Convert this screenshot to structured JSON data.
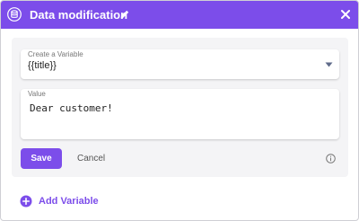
{
  "dialog": {
    "title": "Data modification",
    "title_icon": "database-icon",
    "edit_icon": "pencil-icon",
    "close_icon": "close-icon",
    "colors": {
      "accent": "#7c4dea",
      "panel": "#f4f4f6"
    }
  },
  "form": {
    "variable": {
      "label": "Create a Variable",
      "value": "{{title}}",
      "icon": "caret-down-icon"
    },
    "value": {
      "label": "Value",
      "text": "Dear customer!"
    },
    "save_label": "Save",
    "cancel_label": "Cancel",
    "info_icon": "info-icon"
  },
  "add_variable": {
    "label": "Add Variable",
    "icon": "plus-circle-icon"
  }
}
